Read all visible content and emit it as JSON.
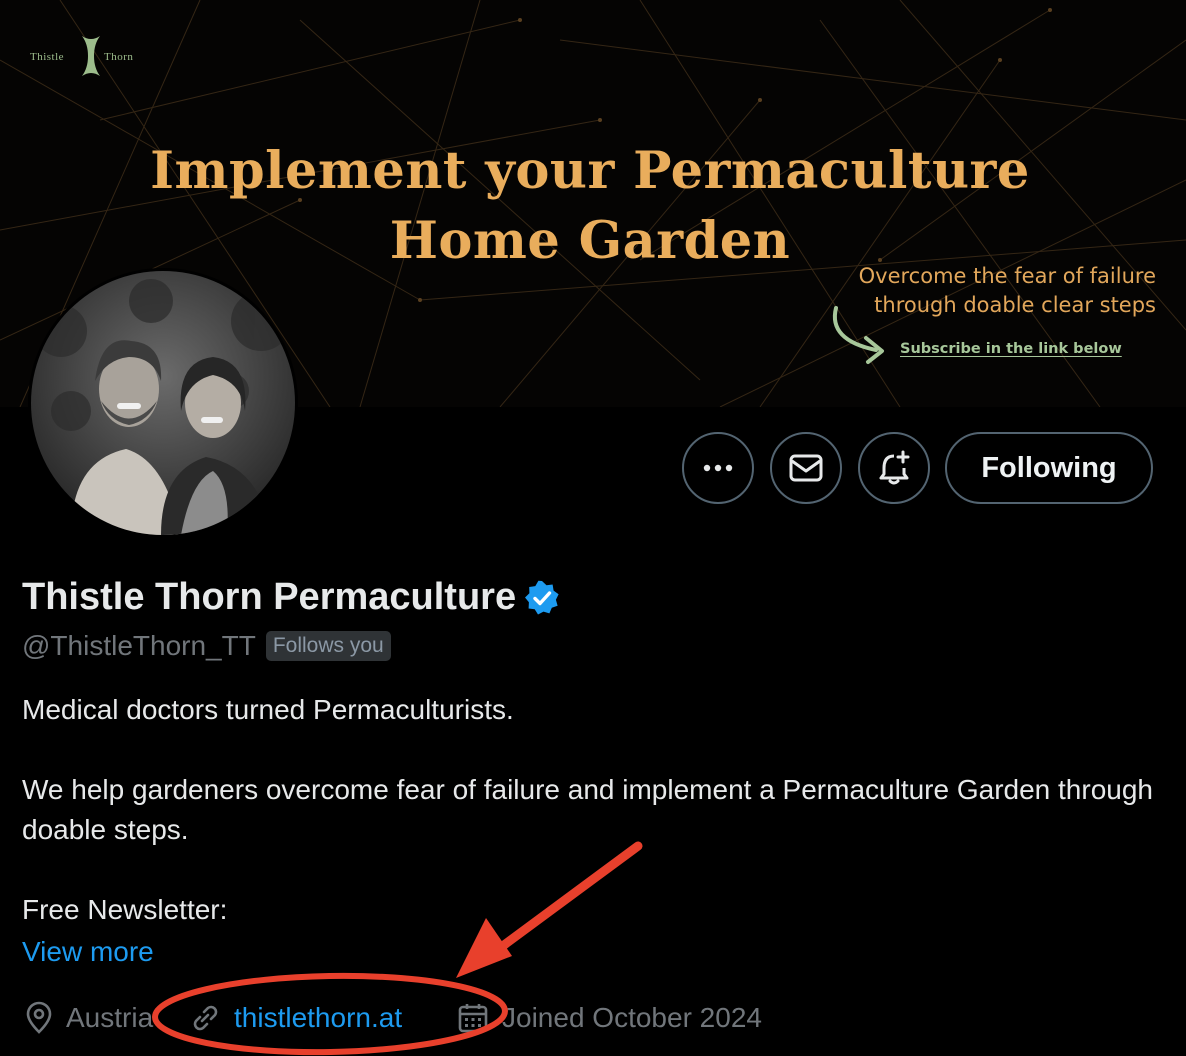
{
  "banner": {
    "logo_left": "Thistle",
    "logo_right": "Thorn",
    "headline_line1": "Implement your Permaculture",
    "headline_line2": "Home Garden",
    "tagline_line1": "Overcome the fear of failure",
    "tagline_line2": "through doable clear steps",
    "subscribe_text": "Subscribe in the link below"
  },
  "actions": {
    "more_icon": "more-horizontal-icon",
    "message_icon": "envelope-icon",
    "notify_icon": "bell-plus-icon",
    "following_label": "Following"
  },
  "profile": {
    "display_name": "Thistle Thorn Permaculture",
    "verified_icon": "verified-badge-icon",
    "handle": "@ThistleThorn_TT",
    "follows_you": "Follows you",
    "bio_line1": "Medical doctors turned Permaculturists.",
    "bio_line2": "We help gardeners overcome fear of failure and implement a Permaculture Garden through doable steps.",
    "bio_line3": "Free Newsletter:",
    "view_more": "View more",
    "location": "Austria",
    "location_icon": "location-pin-icon",
    "website": "thistlethorn.at",
    "website_icon": "link-icon",
    "joined": "Joined October 2024",
    "joined_icon": "calendar-icon"
  },
  "colors": {
    "headline": "#e9ad5c",
    "accent_green": "#a7c79a",
    "link_blue": "#1d9bf0",
    "annotation_red": "#e8402c"
  }
}
